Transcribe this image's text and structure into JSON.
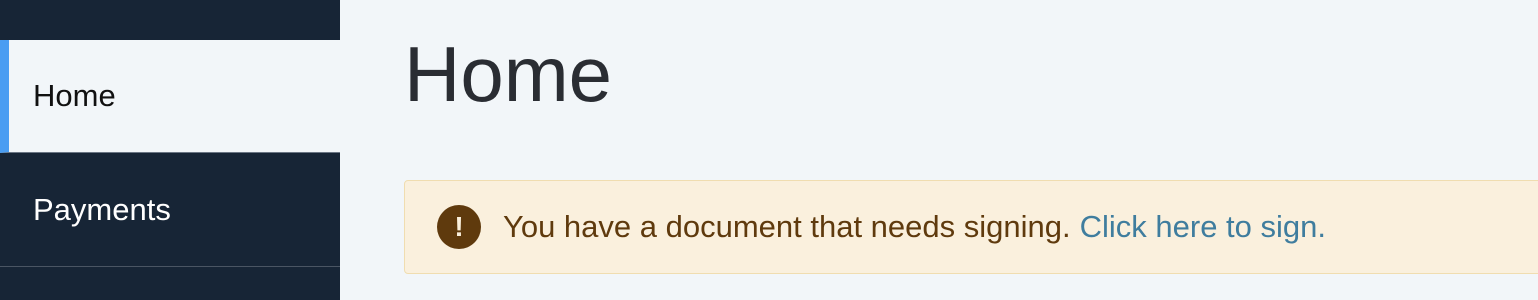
{
  "sidebar": {
    "items": [
      {
        "label": "Home",
        "active": true
      },
      {
        "label": "Payments",
        "active": false
      }
    ]
  },
  "main": {
    "title": "Home",
    "alert": {
      "icon": "exclamation-circle-icon",
      "icon_glyph": "!",
      "message": "You have a document that needs signing.",
      "link_text": "Click here to sign."
    }
  },
  "colors": {
    "sidebar_bg": "#172536",
    "active_accent": "#4a9df2",
    "page_bg": "#f2f6f9",
    "alert_bg": "#faf0dd",
    "alert_text": "#5f3a0d",
    "link": "#3f7d9e"
  }
}
